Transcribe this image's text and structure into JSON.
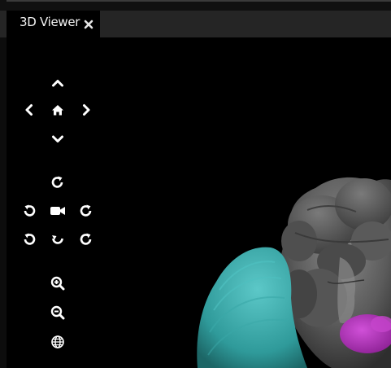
{
  "tab": {
    "title": "3D Viewer",
    "close_icon": "close-icon"
  },
  "controls": {
    "pan": [
      "pan-up-icon",
      "pan-left-icon",
      "home-icon",
      "pan-right-icon",
      "pan-down-icon"
    ],
    "rotate": [
      "rotate-reset-icon",
      "rotate-left-icon",
      "camera-icon",
      "rotate-right-icon",
      "rotate-ccw-icon",
      "rotate-axis-icon",
      "rotate-cw-icon"
    ],
    "zoom": [
      "zoom-in-icon",
      "zoom-out-icon",
      "globe-icon"
    ]
  },
  "scene": {
    "colors": {
      "background": "#000000",
      "brain": "#6a6a6a",
      "cyan_region": "#3fb2b2",
      "magenta_region": "#b02fb8"
    }
  }
}
